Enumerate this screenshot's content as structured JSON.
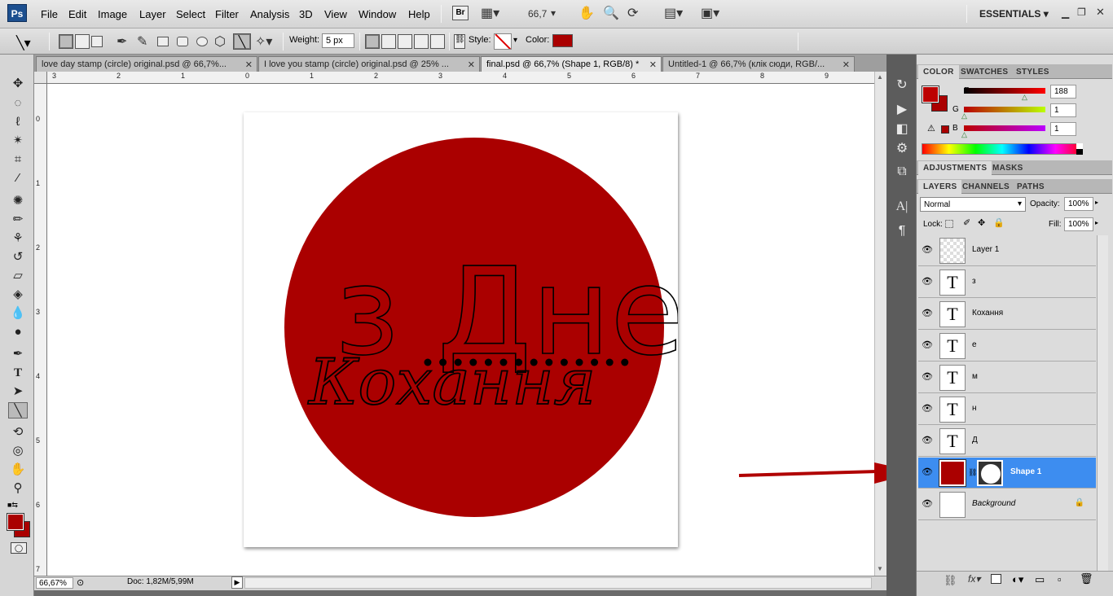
{
  "app": {
    "logo": "Ps",
    "workspace": "ESSENTIALS",
    "zoom_field": "66,7"
  },
  "menu": [
    "File",
    "Edit",
    "Image",
    "Layer",
    "Select",
    "Filter",
    "Analysis",
    "3D",
    "View",
    "Window",
    "Help"
  ],
  "options": {
    "weight_label": "Weight:",
    "weight_value": "5 px",
    "style_label": "Style:",
    "color_label": "Color:",
    "color": "#aa0000"
  },
  "doc_tabs": [
    {
      "label": "love day stamp (circle) original.psd @ 66,7%..."
    },
    {
      "label": "I love you stamp (circle) original.psd @ 25% ..."
    },
    {
      "label": "final.psd @ 66,7% (Shape 1, RGB/8) *"
    },
    {
      "label": "Untitled-1 @ 66,7% (клік сюди, RGB/..."
    }
  ],
  "ruler_h": [
    "3",
    "2",
    "1",
    "0",
    "1",
    "2",
    "3",
    "4",
    "5",
    "6",
    "7",
    "8",
    "9"
  ],
  "ruler_v": [
    "0",
    "1",
    "2",
    "3",
    "4",
    "5",
    "6",
    "7"
  ],
  "status": {
    "zoom": "66,67%",
    "doc": "Doc: 1,82M/5,99M"
  },
  "color_panel": {
    "tabs": [
      "COLOR",
      "SWATCHES",
      "STYLES"
    ],
    "r_label": "R",
    "g_label": "G",
    "b_label": "B",
    "r": "188",
    "g": "1",
    "b": "1",
    "fg": "#bc0101"
  },
  "adjust_tabs": [
    "ADJUSTMENTS",
    "MASKS"
  ],
  "layers_panel": {
    "tabs": [
      "LAYERS",
      "CHANNELS",
      "PATHS"
    ],
    "blend": "Normal",
    "opacity_label": "Opacity:",
    "opacity": "100%",
    "lock_label": "Lock:",
    "fill_label": "Fill:",
    "fill": "100%",
    "layers": [
      {
        "name": "Layer 1",
        "thumb": ""
      },
      {
        "name": "з",
        "thumb": "T"
      },
      {
        "name": "Кохання",
        "thumb": "T"
      },
      {
        "name": "е",
        "thumb": "T"
      },
      {
        "name": "м",
        "thumb": "T"
      },
      {
        "name": "н",
        "thumb": "T"
      },
      {
        "name": "Д",
        "thumb": "T"
      },
      {
        "name": "Shape 1",
        "thumb": ""
      },
      {
        "name": "Background",
        "thumb": ""
      }
    ]
  },
  "artwork": {
    "circle_color": "#aa0000",
    "top_text": "з Днем",
    "bottom_text": "Кохання"
  }
}
